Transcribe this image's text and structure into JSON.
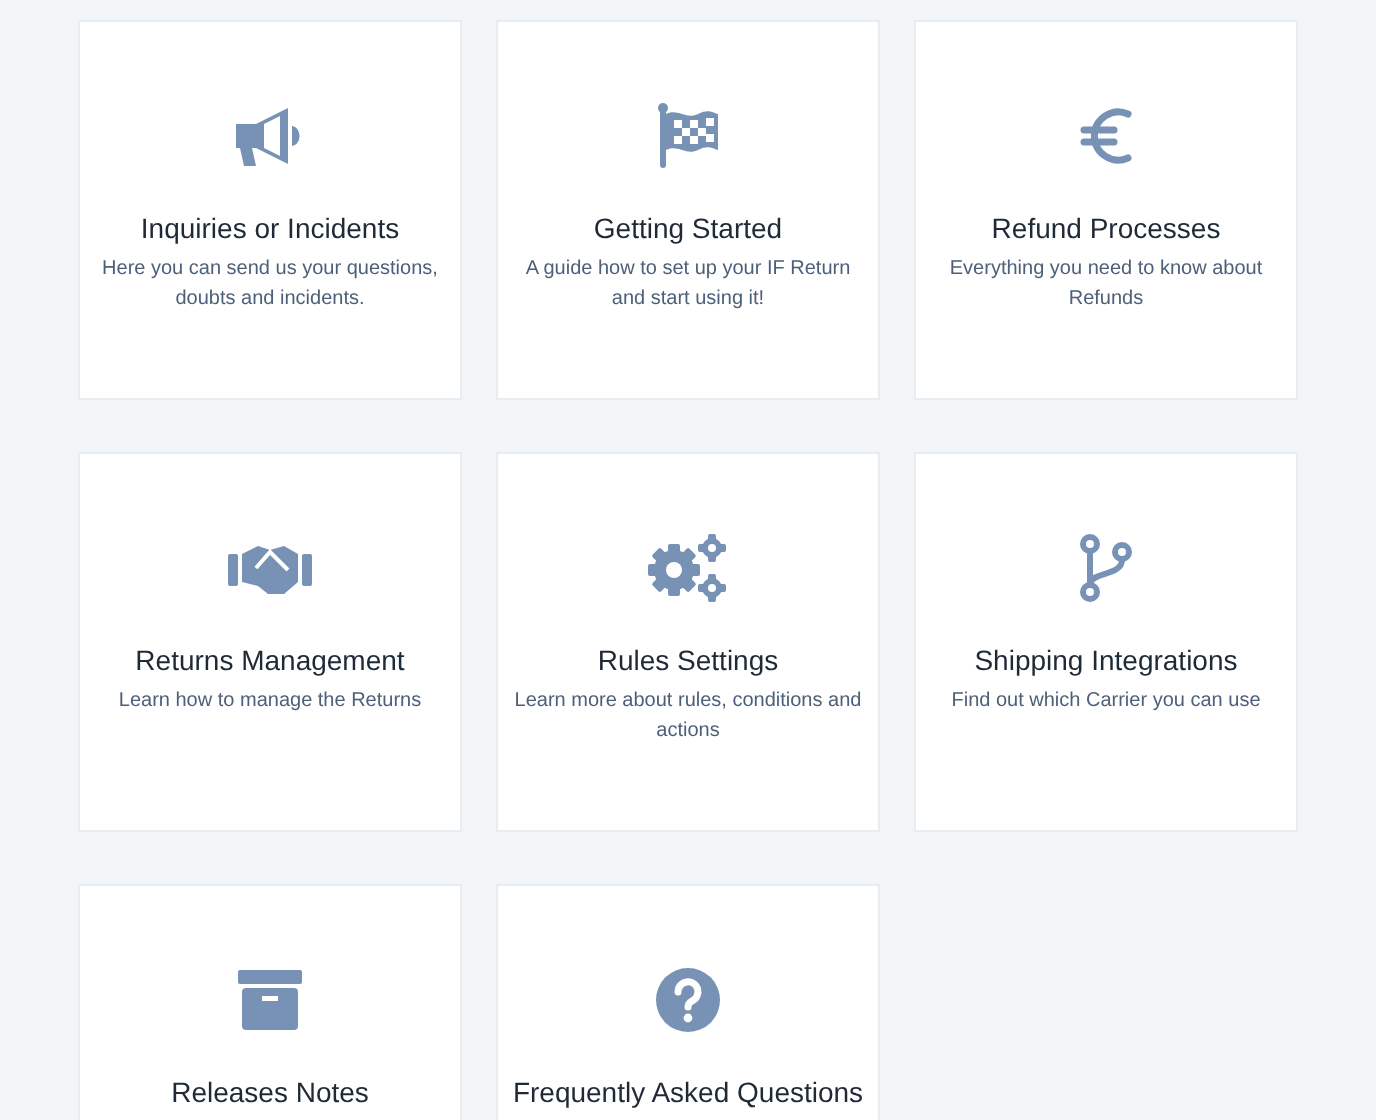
{
  "cards": [
    {
      "title": "Inquiries or Incidents",
      "description": "Here you can send us your questions, doubts and incidents."
    },
    {
      "title": "Getting Started",
      "description": "A guide how to set up your IF Return and start using it!"
    },
    {
      "title": "Refund Processes",
      "description": "Everything you need to know about Refunds"
    },
    {
      "title": "Returns Management",
      "description": "Learn how to manage the Returns"
    },
    {
      "title": "Rules Settings",
      "description": "Learn more about rules, conditions and actions"
    },
    {
      "title": "Shipping Integrations",
      "description": "Find out which Carrier you can use"
    },
    {
      "title": "Releases Notes"
    },
    {
      "title": "Frequently Asked Questions"
    }
  ]
}
